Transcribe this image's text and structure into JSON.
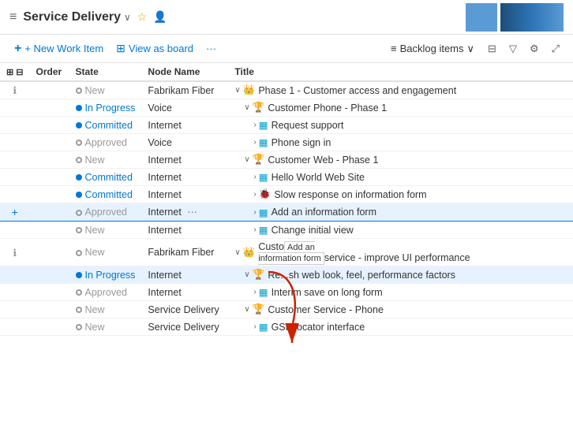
{
  "header": {
    "icon": "≡",
    "title": "Service Delivery",
    "chevron": "∨",
    "star": "★",
    "person": "👤"
  },
  "toolbar": {
    "new_work_item": "+ New Work Item",
    "view_as_board": "View as board",
    "more": "···",
    "backlog_items": "Backlog items",
    "chevron_down": "∨"
  },
  "table": {
    "columns": [
      "Order",
      "State",
      "Node Name",
      "Title"
    ],
    "rows": [
      {
        "id": 1,
        "info": "ℹ",
        "order": "",
        "state": "New",
        "state_type": "new",
        "node": "Fabrikam Fiber",
        "indent": 0,
        "expand": "∨",
        "wi_type": "epic",
        "wi_icon": "👑",
        "title": "Phase 1 - Customer access and engagement"
      },
      {
        "id": 2,
        "info": "",
        "order": "",
        "state": "In Progress",
        "state_type": "inprogress",
        "node": "Voice",
        "indent": 1,
        "expand": "∨",
        "wi_type": "feature",
        "wi_icon": "🏆",
        "title": "Customer Phone - Phase 1"
      },
      {
        "id": 3,
        "info": "",
        "order": "",
        "state": "Committed",
        "state_type": "committed",
        "node": "Internet",
        "indent": 2,
        "expand": "›",
        "wi_type": "story",
        "wi_icon": "▦",
        "title": "Request support"
      },
      {
        "id": 4,
        "info": "",
        "order": "",
        "state": "Approved",
        "state_type": "approved",
        "node": "Voice",
        "indent": 2,
        "expand": "›",
        "wi_type": "story",
        "wi_icon": "▦",
        "title": "Phone sign in"
      },
      {
        "id": 5,
        "info": "",
        "order": "",
        "state": "New",
        "state_type": "new",
        "node": "Internet",
        "indent": 1,
        "expand": "∨",
        "wi_type": "feature",
        "wi_icon": "🏆",
        "title": "Customer Web - Phase 1"
      },
      {
        "id": 6,
        "info": "",
        "order": "",
        "state": "Committed",
        "state_type": "committed",
        "node": "Internet",
        "indent": 2,
        "expand": "›",
        "wi_type": "story",
        "wi_icon": "▦",
        "title": "Hello World Web Site"
      },
      {
        "id": 7,
        "info": "",
        "order": "",
        "state": "Committed",
        "state_type": "committed",
        "node": "Internet",
        "indent": 2,
        "expand": "›",
        "wi_type": "bug",
        "wi_icon": "🐞",
        "title": "Slow response on information form"
      },
      {
        "id": 8,
        "info": "",
        "order": "",
        "state": "Approved",
        "state_type": "approved",
        "node": "Internet",
        "indent": 2,
        "expand": "›",
        "wi_type": "story",
        "wi_icon": "▦",
        "title": "Add an information form",
        "highlighted": true,
        "has_ellipsis": true
      },
      {
        "id": 9,
        "info": "",
        "order": "",
        "state": "New",
        "state_type": "new",
        "node": "Internet",
        "indent": 2,
        "expand": "›",
        "wi_type": "story",
        "wi_icon": "▦",
        "title": "Change initial view"
      },
      {
        "id": 10,
        "info": "ℹ",
        "order": "",
        "state": "New",
        "state_type": "new",
        "node": "Fabrikam Fiber",
        "indent": 0,
        "expand": "∨",
        "wi_type": "epic",
        "wi_icon": "👑",
        "title": "Custo... - improve UI performance"
      },
      {
        "id": 11,
        "info": "",
        "order": "",
        "state": "In Progress",
        "state_type": "inprogress",
        "node": "Internet",
        "indent": 1,
        "expand": "∨",
        "wi_type": "feature",
        "wi_icon": "🏆",
        "title": "Re...sh web look, feel, performance factors",
        "highlighted": true
      },
      {
        "id": 12,
        "info": "",
        "order": "",
        "state": "Approved",
        "state_type": "approved",
        "node": "Internet",
        "indent": 2,
        "expand": "›",
        "wi_type": "story",
        "wi_icon": "▦",
        "title": "Interim save on long form"
      },
      {
        "id": 13,
        "info": "",
        "order": "",
        "state": "New",
        "state_type": "new",
        "node": "Service Delivery",
        "indent": 1,
        "expand": "∨",
        "wi_type": "feature",
        "wi_icon": "🏆",
        "title": "Customer Service - Phone"
      },
      {
        "id": 14,
        "info": "",
        "order": "",
        "state": "New",
        "state_type": "new",
        "node": "Service Delivery",
        "indent": 2,
        "expand": "›",
        "wi_type": "story",
        "wi_icon": "▦",
        "title": "GSP locator interface"
      }
    ]
  },
  "tooltip": {
    "line1": "Add an",
    "line2": "information form"
  }
}
